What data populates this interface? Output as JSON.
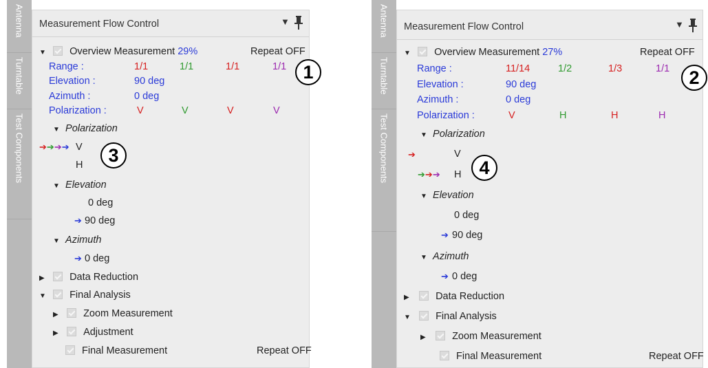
{
  "left": {
    "tabs": [
      "Antenna",
      "Turntable",
      "Test Components"
    ],
    "title": "Measurement Flow Control",
    "overview_label": "Overview Measurement",
    "percent": "29%",
    "repeat": "Repeat OFF",
    "range_label": "Range :",
    "range_values": [
      "1/1",
      "1/1",
      "1/1",
      "1/1"
    ],
    "elevation_label": "Elevation :",
    "elevation_value": "90 deg",
    "azimuth_label": "Azimuth :",
    "azimuth_value": "0 deg",
    "polarization_label": "Polarization :",
    "polarization_values": [
      "V",
      "V",
      "V",
      "V"
    ],
    "pol_group": "Polarization",
    "pol_items": [
      "V",
      "H"
    ],
    "elev_group": "Elevation",
    "elev_items": [
      "0 deg",
      "90 deg"
    ],
    "azi_group": "Azimuth",
    "azi_items": [
      "0 deg"
    ],
    "data_reduction": "Data Reduction",
    "final_analysis": "Final Analysis",
    "zoom": "Zoom Measurement",
    "adjustment": "Adjustment",
    "final_measurement": "Final Measurement",
    "final_repeat": "Repeat OFF",
    "callout_a": "1",
    "callout_b": "3"
  },
  "right": {
    "tabs": [
      "Antenna",
      "Turntable",
      "Test Components"
    ],
    "title": "Measurement Flow Control",
    "overview_label": "Overview Measurement",
    "percent": "27%",
    "repeat": "Repeat OFF",
    "range_label": "Range :",
    "range_values": [
      "11/14",
      "1/2",
      "1/3",
      "1/1"
    ],
    "elevation_label": "Elevation :",
    "elevation_value": "90 deg",
    "azimuth_label": "Azimuth :",
    "azimuth_value": "0 deg",
    "polarization_label": "Polarization :",
    "polarization_values": [
      "V",
      "H",
      "H",
      "H"
    ],
    "pol_group": "Polarization",
    "pol_items": [
      "V",
      "H"
    ],
    "elev_group": "Elevation",
    "elev_items": [
      "0 deg",
      "90 deg"
    ],
    "azi_group": "Azimuth",
    "azi_items": [
      "0 deg"
    ],
    "data_reduction": "Data Reduction",
    "final_analysis": "Final Analysis",
    "zoom": "Zoom Measurement",
    "final_measurement": "Final Measurement",
    "final_repeat": "Repeat OFF",
    "callout_a": "2",
    "callout_b": "4"
  },
  "colors": {
    "first": "#d62020",
    "second": "#2f9a2f",
    "third": "#9c2ab0",
    "fourth": "#2a3ad8",
    "label_blue": "#2a3ad8",
    "sidebar": "#b9b9b9",
    "panel": "#ededed"
  }
}
